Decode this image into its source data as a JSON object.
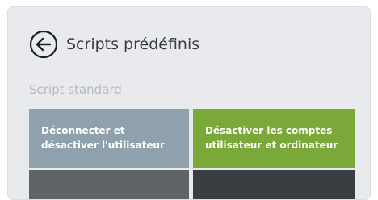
{
  "header": {
    "title": "Scripts prédéfinis",
    "back_icon": "arrow-left-circle-icon"
  },
  "section": {
    "label": "Script standard"
  },
  "tiles": [
    {
      "label": "Déconnecter et désactiver l'utilisateur",
      "color": "#8fa1ad"
    },
    {
      "label": "Désactiver les comptes utilisateur et ordinateur",
      "color": "#7aa93a"
    },
    {
      "label": "",
      "color": "#5f6467"
    },
    {
      "label": "",
      "color": "#3a3e42"
    }
  ]
}
